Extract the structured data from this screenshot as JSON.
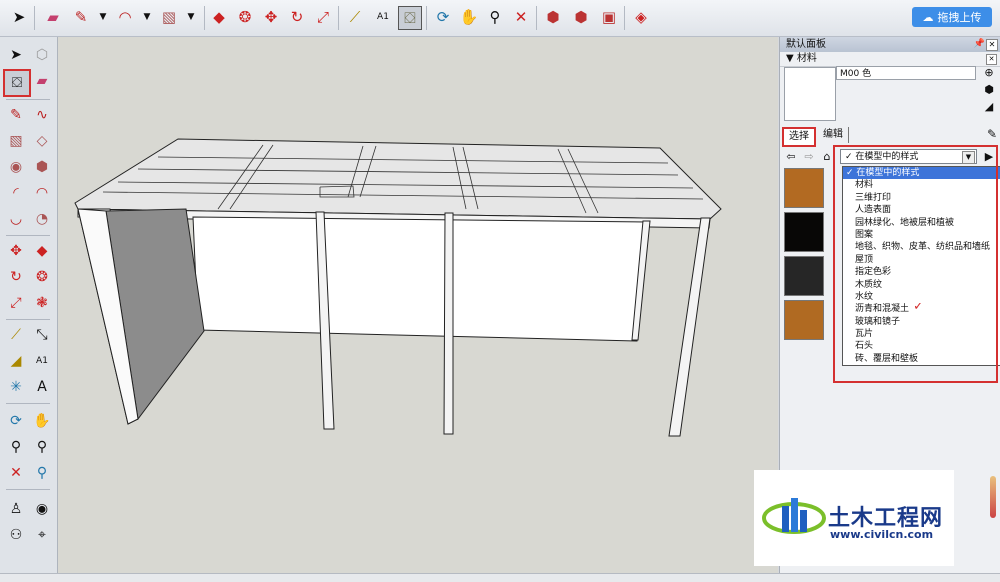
{
  "toolbar": {
    "upload_label": "拖拽上传"
  },
  "tray": {
    "title": "默认面板",
    "materials_header": "材料",
    "material_name": "M00 色",
    "tabs": {
      "select": "选择",
      "edit": "编辑"
    },
    "combo_value": "在模型中的样式",
    "dropdown_items": [
      "在模型中的样式",
      "材料",
      "三维打印",
      "人造表面",
      "园林绿化、地被层和植被",
      "图案",
      "地毯、织物、皮革、纺织品和墙纸",
      "屋顶",
      "指定色彩",
      "木质纹",
      "水纹",
      "沥青和混凝土",
      "玻璃和镜子",
      "瓦片",
      "石头",
      "砖、覆层和壁板"
    ],
    "swatch_colors": [
      "#b26a22",
      "#080706",
      "#262626",
      "#b06a22"
    ]
  },
  "watermark": {
    "brand": "土木工程网",
    "url": "www.civilcn.com"
  },
  "colors": {
    "accent": "#3d8ee8",
    "highlight": "#3d74d9",
    "red_box": "#d43030"
  }
}
